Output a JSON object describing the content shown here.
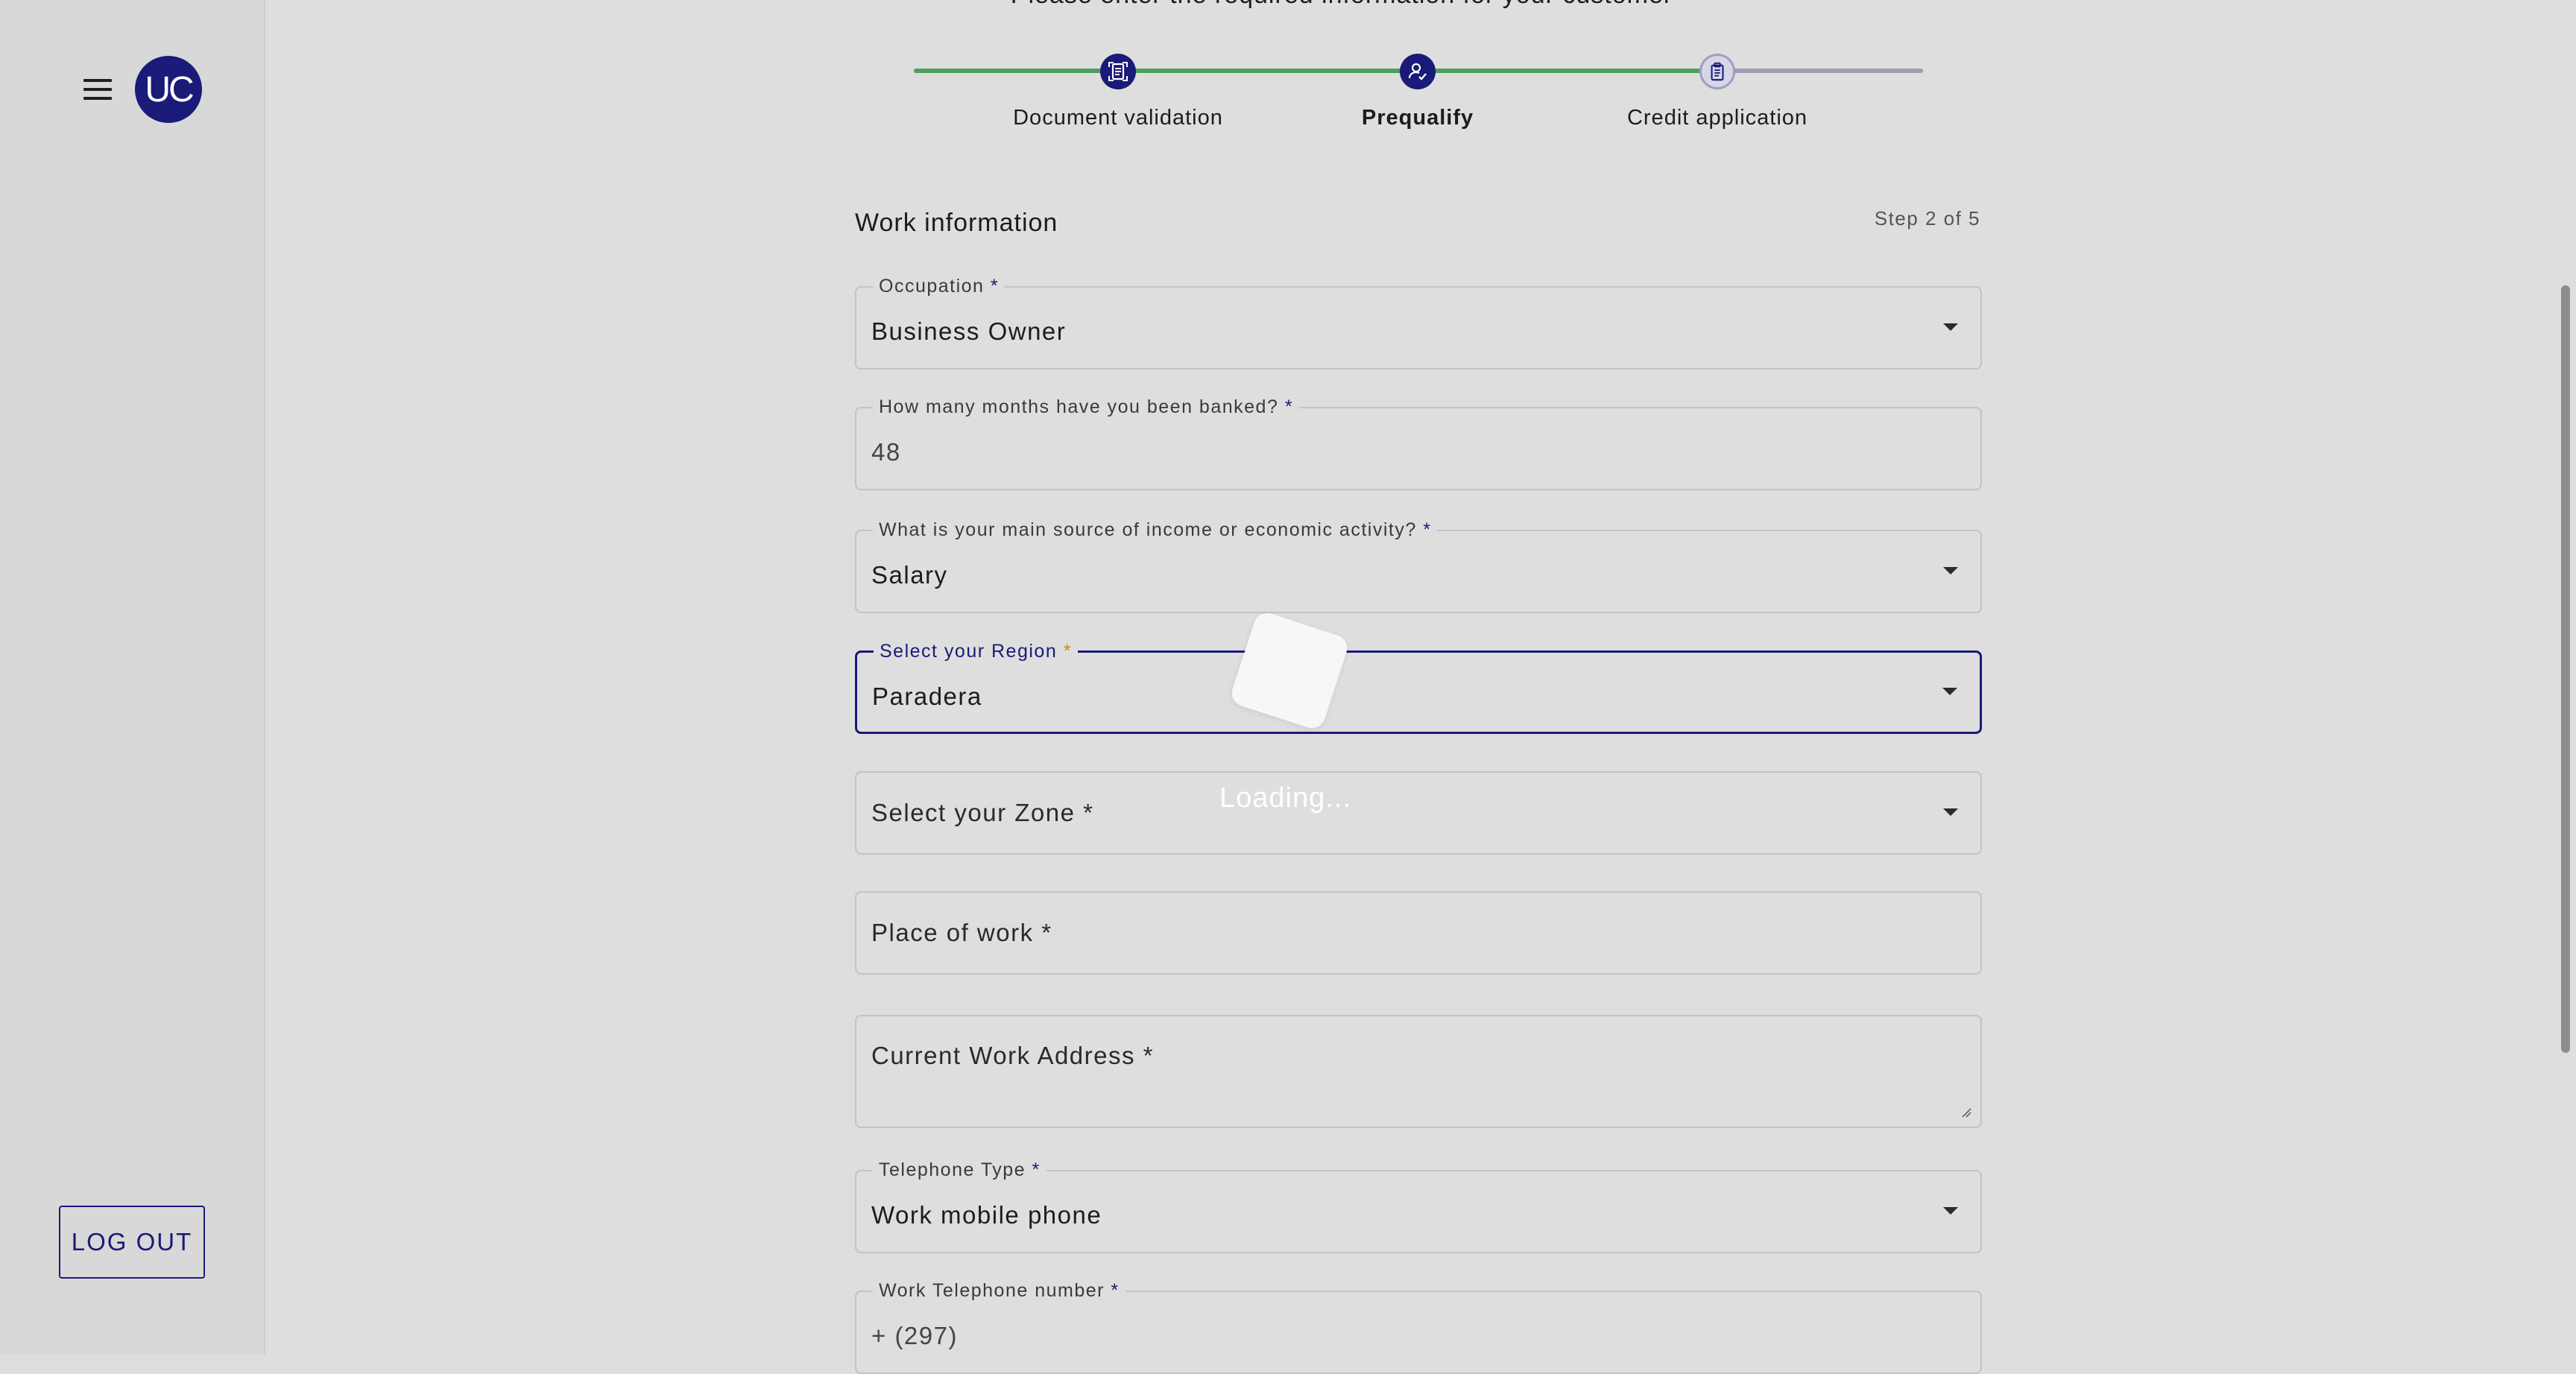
{
  "sidebar": {
    "menu_icon": "hamburger-menu-icon",
    "avatar_initials": "UC",
    "logout_label": "LOG OUT"
  },
  "header": {
    "instruction": "Please enter the required information for your customer"
  },
  "stepper": {
    "steps": [
      {
        "label": "Document validation",
        "state": "completed",
        "icon": "document-scan-icon"
      },
      {
        "label": "Prequalify",
        "state": "current",
        "icon": "user-check-icon"
      },
      {
        "label": "Credit application",
        "state": "pending",
        "icon": "clipboard-icon"
      }
    ],
    "colors": {
      "done": "#4e9e5e",
      "pending": "#9e9eb4",
      "active": "#1a1a78"
    }
  },
  "form": {
    "section_title": "Work information",
    "step_counter": "Step 2 of 5",
    "occupation": {
      "label": "Occupation",
      "value": "Business Owner"
    },
    "months_banked": {
      "label": "How many months have you been banked?",
      "value": "48"
    },
    "income_source": {
      "label": "What is your main source of income or economic activity?",
      "value": "Salary"
    },
    "region": {
      "label": "Select your Region",
      "value": "Paradera"
    },
    "zone": {
      "placeholder": "Select your Zone *"
    },
    "place_of_work": {
      "placeholder": "Place of work *"
    },
    "work_address": {
      "placeholder": "Current Work Address *"
    },
    "telephone_type": {
      "label": "Telephone Type",
      "value": "Work mobile phone"
    },
    "work_phone": {
      "label": "Work Telephone number",
      "value": "+ (297)"
    },
    "required_marker": "*"
  },
  "overlay": {
    "loading_text": "Loading..."
  }
}
